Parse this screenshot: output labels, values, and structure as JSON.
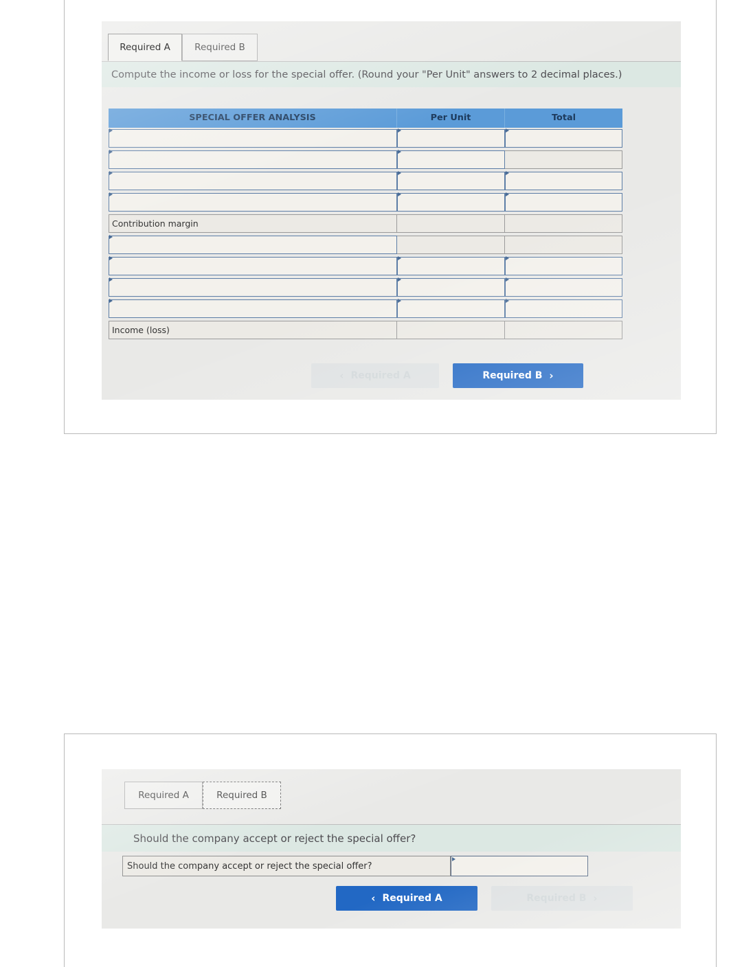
{
  "panel_a": {
    "tabs": [
      {
        "label": "Required A",
        "state": "active"
      },
      {
        "label": "Required B",
        "state": "inactive"
      }
    ],
    "instruction": "Compute the income or loss for the special offer. (Round your \"Per Unit\" answers to 2 decimal places.)",
    "table": {
      "headers": [
        "SPECIAL OFFER ANALYSIS",
        "Per Unit",
        "Total"
      ],
      "rows": [
        {
          "label": "",
          "type": "input",
          "unit": "",
          "total": "",
          "unit_type": "input",
          "total_type": "input"
        },
        {
          "label": "",
          "type": "input",
          "unit": "",
          "total": "",
          "unit_type": "input",
          "total_type": "plain"
        },
        {
          "label": "",
          "type": "input",
          "unit": "",
          "total": "",
          "unit_type": "input",
          "total_type": "input"
        },
        {
          "label": "",
          "type": "input",
          "unit": "",
          "total": "",
          "unit_type": "input",
          "total_type": "input"
        },
        {
          "label": "",
          "type": "input",
          "unit": "",
          "total": "",
          "unit_type": "input",
          "total_type": "input"
        },
        {
          "label": "Contribution margin",
          "type": "plain",
          "unit": "",
          "total": "",
          "unit_type": "blank",
          "total_type": "blank"
        },
        {
          "label": "",
          "type": "input",
          "unit": "",
          "total": "",
          "unit_type": "plain",
          "total_type": "plain"
        },
        {
          "label": "",
          "type": "input",
          "unit": "",
          "total": "",
          "unit_type": "input",
          "total_type": "input"
        },
        {
          "label": "",
          "type": "input",
          "unit": "",
          "total": "",
          "unit_type": "input",
          "total_type": "input"
        },
        {
          "label": "",
          "type": "input",
          "unit": "",
          "total": "",
          "unit_type": "input",
          "total_type": "input"
        },
        {
          "label": "Income (loss)",
          "type": "plain",
          "unit": "",
          "total": "",
          "unit_type": "blank",
          "total_type": "blank"
        }
      ]
    },
    "buttons": {
      "prev": {
        "label": "Required A",
        "chevron": "‹",
        "state": "disabled"
      },
      "next": {
        "label": "Required B",
        "chevron": "›",
        "state": "enabled"
      }
    }
  },
  "panel_b": {
    "tabs": [
      {
        "label": "Required A",
        "state": "inactive"
      },
      {
        "label": "Required B",
        "state": "focused"
      }
    ],
    "instruction": "Should the company accept or reject the special offer?",
    "question": {
      "label": "Should the company accept or reject the special offer?",
      "answer": ""
    },
    "buttons": {
      "prev": {
        "label": "Required A",
        "chevron": "‹",
        "state": "enabled"
      },
      "next": {
        "label": "Required B",
        "chevron": "›",
        "state": "disabled"
      }
    }
  }
}
